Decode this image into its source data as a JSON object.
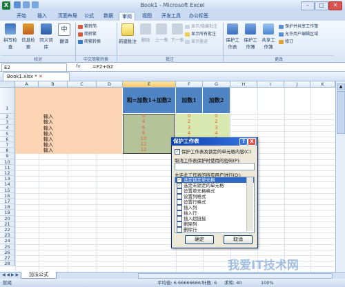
{
  "window": {
    "title": "Book1 - Microsoft Excel",
    "controls": {
      "minimize": "–",
      "maximize": "□",
      "close": "✕"
    }
  },
  "ribbon": {
    "tabs": [
      "开始",
      "插入",
      "页面布局",
      "公式",
      "数据",
      "审阅",
      "视图",
      "开发工具",
      "办公标签"
    ],
    "active_tab": "审阅",
    "proofing": {
      "buttons": [
        "拼写检查",
        "信息检索",
        "同义词库",
        "翻译"
      ],
      "group_label": "校对"
    },
    "chinese_conversion": {
      "buttons": [
        "繁转简",
        "简转繁",
        "简繁转换"
      ],
      "group_label": "中文简繁转换"
    },
    "comments": {
      "new_comment": "新建批注",
      "buttons": [
        "删除",
        "上一条",
        "下一条"
      ],
      "small": [
        "显示/隐藏批注",
        "显示所有批注",
        "显示墨迹"
      ],
      "group_label": "批注"
    },
    "changes": {
      "buttons": [
        "保护工作表",
        "保护工作簿",
        "共享工作簿"
      ],
      "small": [
        "保护并共享工作簿",
        "允许用户编辑区域",
        "修订"
      ],
      "group_label": "更改"
    }
  },
  "formula_bar": {
    "name_box": "E2",
    "fx": "fx",
    "formula": "=F2+G2"
  },
  "document": {
    "tab_label": "Book1.xlsx",
    "tab_marker": "*"
  },
  "sheet": {
    "columns": [
      "A",
      "B",
      "C",
      "D",
      "E",
      "F",
      "G",
      "H",
      "I",
      "J",
      "K"
    ],
    "selected_column": "E",
    "rows": [
      "1",
      "2",
      "3",
      "4",
      "5",
      "6",
      "7",
      "8",
      "9",
      "10",
      "11",
      "12",
      "13",
      "14",
      "15",
      "16",
      "17",
      "18",
      "19",
      "20",
      "21",
      "22",
      "23",
      "24",
      "25",
      "26",
      "27",
      "28"
    ],
    "headers": {
      "E": "和=加数1+加数2",
      "F": "加数1",
      "G": "加数2"
    },
    "input_labels": [
      "输入",
      "输入",
      "输入",
      "输入",
      "输入",
      "输入",
      "输入"
    ],
    "E_values": [
      "0",
      "4",
      "6",
      "8",
      "10",
      "12",
      "12"
    ],
    "F_values": [
      "0",
      "2",
      "3",
      "4",
      "5",
      "6"
    ],
    "G_values": [
      "0",
      "2",
      "3",
      "4",
      "5",
      "6"
    ],
    "colors": {
      "header_fill": "#4e83c4",
      "label_fill": "#fbd4b4",
      "sum_fill": "#b4c39a",
      "addend_fill": "#d8e8b0",
      "value_text": "#e06a3a"
    }
  },
  "sheet_tabs": {
    "nav": "◀ ◀ ▶ ▶",
    "active": "加法公式"
  },
  "status_bar": {
    "state": "就绪",
    "average": "平均值: 6.666666667",
    "count": "计数: 6",
    "sum": "求和: 40",
    "zoom": "100%"
  },
  "dialog": {
    "title": "保护工作表",
    "help": "?",
    "close": "X",
    "protect_checkbox": "保护工作表及锁定的单元格内容(C)",
    "password_label": "取消工作表保护时使用的密码(P):",
    "allow_label": "允许此工作表的所有用户进行(O):",
    "options": [
      {
        "label": "选定锁定单元格",
        "checked": true,
        "selected": true
      },
      {
        "label": "选定未锁定的单元格",
        "checked": true,
        "selected": false
      },
      {
        "label": "设置单元格格式",
        "checked": false,
        "selected": false
      },
      {
        "label": "设置列格式",
        "checked": false,
        "selected": false
      },
      {
        "label": "设置行格式",
        "checked": false,
        "selected": false
      },
      {
        "label": "插入列",
        "checked": false,
        "selected": false
      },
      {
        "label": "插入行",
        "checked": false,
        "selected": false
      },
      {
        "label": "插入超链接",
        "checked": false,
        "selected": false
      },
      {
        "label": "删除列",
        "checked": false,
        "selected": false
      },
      {
        "label": "删除行",
        "checked": false,
        "selected": false
      }
    ],
    "ok": "确定",
    "cancel": "取消"
  },
  "watermark": "我爱IT技术网"
}
